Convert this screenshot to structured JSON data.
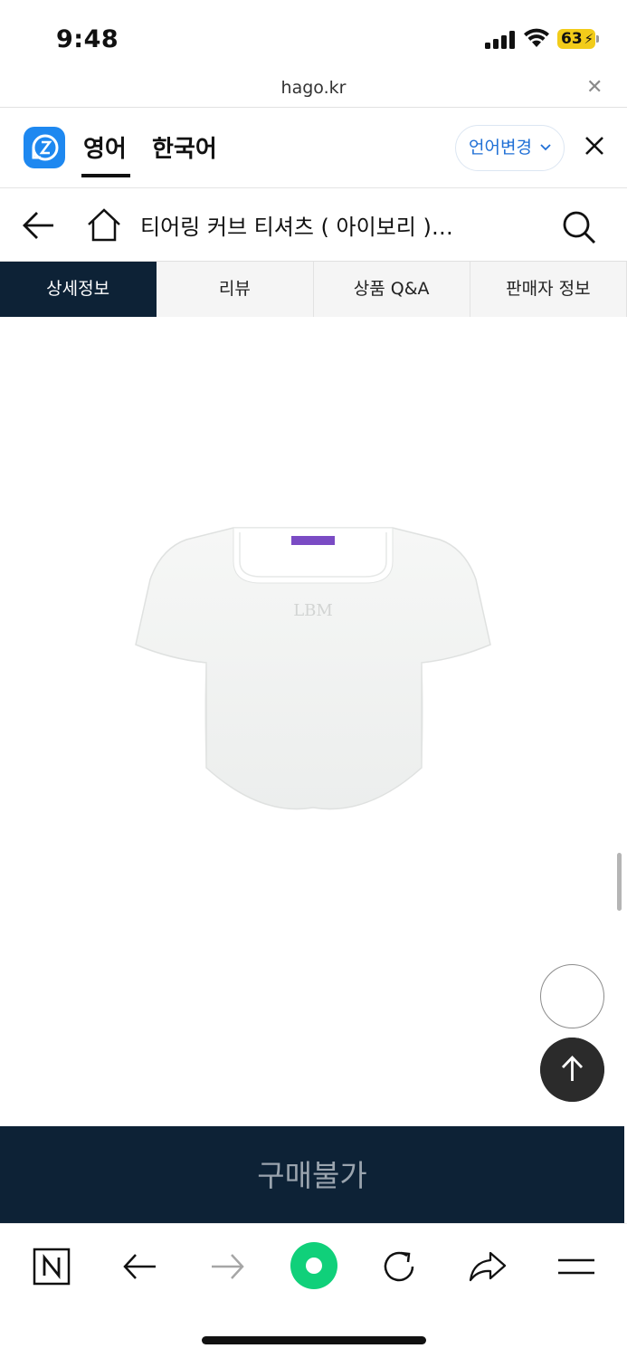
{
  "status_bar": {
    "time": "9:48",
    "battery": "63"
  },
  "url_bar": {
    "url": "hago.kr"
  },
  "translate_bar": {
    "lang_source": "영어",
    "lang_target": "한국어",
    "change_label": "언어변경",
    "accent_color": "#1f6fd6"
  },
  "product_header": {
    "title": "티어링 커브 티셔츠 ( 아이보리 )…"
  },
  "tabs": [
    {
      "label": "상세정보",
      "active": true
    },
    {
      "label": "리뷰",
      "active": false
    },
    {
      "label": "상품 Q&A",
      "active": false
    },
    {
      "label": "판매자 정보",
      "active": false
    }
  ],
  "product_image": {
    "logo_text": "LBM",
    "brand_color": "#7a4bc4"
  },
  "buy_bar": {
    "label": "구매불가",
    "background": "#0d2236"
  },
  "icons": {
    "papago": "papago-logo-icon",
    "back": "arrow-left-icon",
    "home": "home-icon",
    "search": "search-icon",
    "scroll_top": "arrow-up-icon",
    "naver": "naver-n-icon",
    "reload": "reload-icon",
    "share": "share-icon",
    "menu": "menu-icon"
  }
}
